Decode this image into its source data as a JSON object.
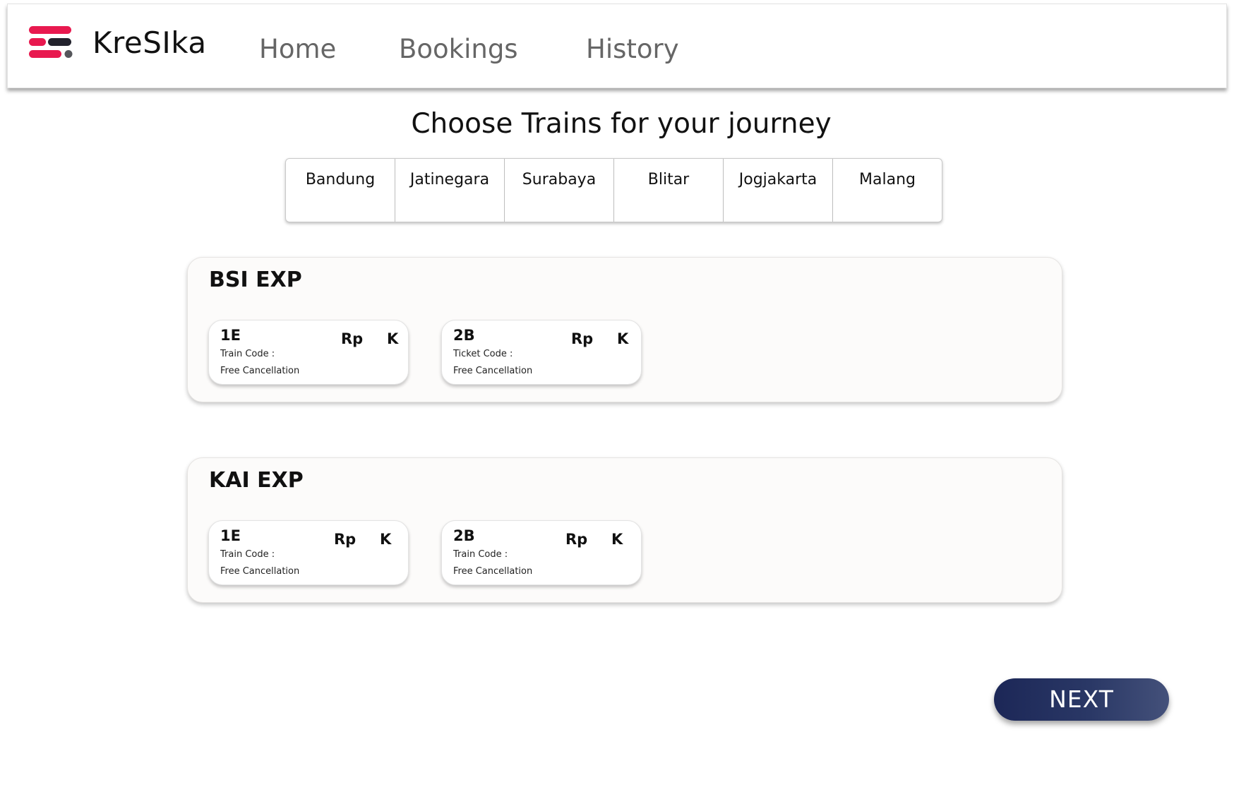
{
  "header": {
    "brand": "KreSIka",
    "nav": {
      "home": "Home",
      "bookings": "Bookings",
      "history": "History"
    }
  },
  "main": {
    "title": "Choose Trains for your journey",
    "cities": [
      "Bandung",
      "Jatinegara",
      "Surabaya",
      "Blitar",
      "Jogjakarta",
      "Malang"
    ],
    "trains": [
      {
        "name": "BSI EXP",
        "options": [
          {
            "class": "1E",
            "code_label": "Train Code :",
            "cancellation": "Free Cancellation",
            "currency": "Rp",
            "unit": "K"
          },
          {
            "class": "2B",
            "code_label": "Ticket Code :",
            "cancellation": "Free Cancellation",
            "currency": "Rp",
            "unit": "K"
          }
        ]
      },
      {
        "name": "KAI EXP",
        "options": [
          {
            "class": "1E",
            "code_label": "Train Code :",
            "cancellation": "Free Cancellation",
            "currency": "Rp",
            "unit": "K"
          },
          {
            "class": "2B",
            "code_label": "Train Code :",
            "cancellation": "Free Cancellation",
            "currency": "Rp",
            "unit": "K"
          }
        ]
      }
    ]
  },
  "actions": {
    "next_label": "NEXT"
  },
  "icons": {
    "logo": "logo-icon"
  },
  "colors": {
    "logo_red": "#e8194f",
    "logo_dark": "#23232d",
    "logo_grey": "#55565b",
    "button_start": "#1c2757",
    "button_end": "#44517a",
    "nav_text": "#666666"
  }
}
